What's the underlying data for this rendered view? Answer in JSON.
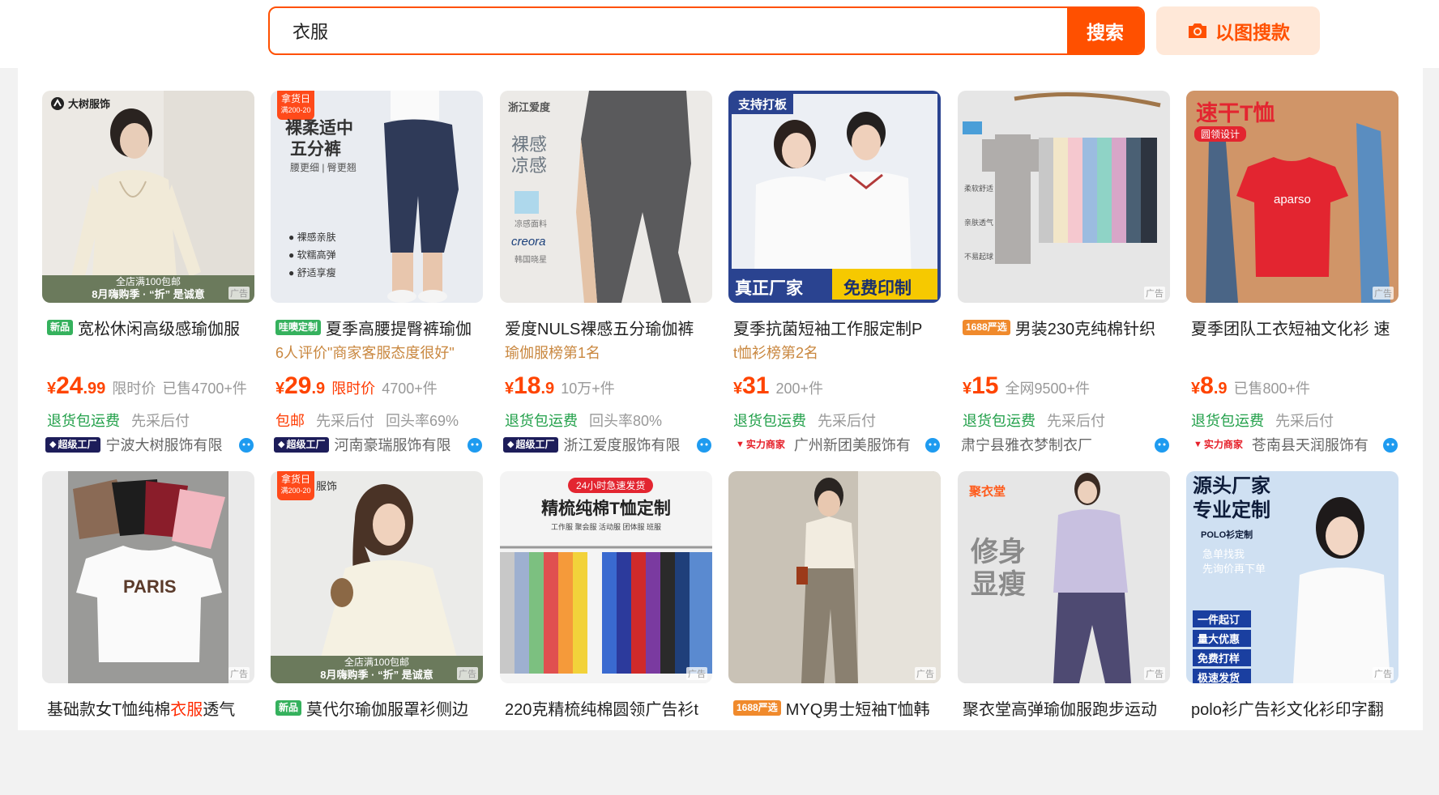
{
  "search": {
    "query": "衣服",
    "button_label": "搜索",
    "image_search_label": "以图搜款"
  },
  "colors": {
    "accent": "#ff5000",
    "price": "#ff4400",
    "green": "#22a04a"
  },
  "products_row1": [
    {
      "badge": "新品",
      "title": "宽松休闲高级感瑜伽服",
      "price_yen": "¥",
      "price_int": "24",
      "price_dec": ".99",
      "extra1": "限时价",
      "extra2": "已售4700+件",
      "tag1": "退货包运费",
      "tag2": "先采后付",
      "shop_badge": "超级工厂",
      "shop_name": "宁波大树服饰有限",
      "thumb_brand": "大树服饰",
      "thumb_footer1": "8月嗨购季 · “折” 是诚意",
      "thumb_footer2": "全店满100包邮",
      "ad": "广告"
    },
    {
      "badge": "哇噢定制",
      "title": "夏季高腰提臀裤瑜伽",
      "sub": "6人评价\"商家客服态度很好\"",
      "price_yen": "¥",
      "price_int": "29",
      "price_dec": ".9",
      "extra1": "限时价",
      "extra2": "4700+件",
      "tag1": "包邮",
      "tag2": "先采后付",
      "tag3": "回头率69%",
      "shop_badge": "超级工厂",
      "shop_name": "河南豪瑞服饰有限",
      "thumb_promo1": "拿货日",
      "thumb_promo2": "满200-20",
      "thumb_text1": "裸柔适中",
      "thumb_text2": "五分裤",
      "thumb_text3": "腰更细 | 臀更翘",
      "thumb_feat1": "裸感亲肤",
      "thumb_feat2": "软糯高弹",
      "thumb_feat3": "舒适享瘦",
      "ad": "广告"
    },
    {
      "title": "爱度NULS裸感五分瑜伽裤",
      "sub": "瑜伽服榜第1名",
      "price_yen": "¥",
      "price_int": "18",
      "price_dec": ".9",
      "extra2": "10万+件",
      "tag1": "退货包运费",
      "tag2": "回头率80%",
      "shop_badge": "超级工厂",
      "shop_name": "浙江爱度服饰有限",
      "thumb_text1": "浙江爱度",
      "thumb_text2": "裸感",
      "thumb_text3": "凉感",
      "thumb_text4": "凉感面料",
      "thumb_text5": "creora",
      "thumb_text6": "韩国晓星",
      "ad": "广告"
    },
    {
      "title": "夏季抗菌短袖工作服定制P",
      "sub": "t恤衫榜第2名",
      "price_yen": "¥",
      "price_int": "31",
      "price_dec": "",
      "extra2": "200+件",
      "tag1": "退货包运费",
      "tag2": "先采后付",
      "shop_badge": "实力商家",
      "shop_name": "广州新团美服饰有",
      "thumb_text1": "支持打板",
      "thumb_text2": "真正厂家",
      "thumb_text3": "免费印制",
      "ad": "广告"
    },
    {
      "badge": "1688严选",
      "title": "男装230克纯棉针织",
      "price_yen": "¥",
      "price_int": "15",
      "price_dec": "",
      "extra2": "全网9500+件",
      "tag1": "退货包运费",
      "tag2": "先采后付",
      "shop_name": "肃宁县雅衣梦制衣厂",
      "thumb_text1": "柔软舒适",
      "thumb_text2": "亲肤透气",
      "thumb_text3": "不易起球",
      "ad": "广告"
    },
    {
      "title": "夏季团队工衣短袖文化衫 速",
      "price_yen": "¥",
      "price_int": "8",
      "price_dec": ".9",
      "extra2": "已售800+件",
      "tag1": "退货包运费",
      "tag2": "先采后付",
      "shop_badge": "实力商家",
      "shop_name": "苍南县天润服饰有",
      "thumb_text1": "速干T恤",
      "thumb_text2": "圆领设计",
      "thumb_text3": "aparso",
      "ad": "广告"
    }
  ],
  "products_row2": [
    {
      "title_pre": "基础款女T恤纯棉",
      "title_hl": "衣服",
      "title_post": "透气",
      "thumb_text1": "PARIS",
      "ad": "广告"
    },
    {
      "badge": "新品",
      "title": "莫代尔瑜伽服罩衫侧边",
      "thumb_promo1": "拿货日",
      "thumb_promo2": "满200-20",
      "thumb_text1": "服饰",
      "thumb_footer1": "8月嗨购季 · “折” 是诚意",
      "thumb_footer2": "全店满100包邮",
      "ad": "广告"
    },
    {
      "title": "220克精梳纯棉圆领广告衫t",
      "thumb_text1": "24小时急速发货",
      "thumb_text2": "精梳纯棉T恤定制",
      "thumb_text3": "工作服 聚会服 活动服 团体服 班服",
      "ad": "广告"
    },
    {
      "badge": "1688严选",
      "title": "MYQ男士短袖T恤韩",
      "ad": "广告"
    },
    {
      "title": "聚衣堂高弹瑜伽服跑步运动",
      "thumb_text1": "聚衣堂",
      "thumb_text2": "修身",
      "thumb_text3": "显瘦",
      "ad": "广告"
    },
    {
      "title": "polo衫广告衫文化衫印字翻",
      "thumb_text1": "源头厂家",
      "thumb_text2": "专业定制",
      "thumb_text3": "POLO衫定制",
      "thumb_text4": "急单找我",
      "thumb_text5": "先询价再下单",
      "thumb_feat1": "一件起订",
      "thumb_feat2": "量大优惠",
      "thumb_feat3": "免费打样",
      "thumb_feat4": "极速发货",
      "ad": "广告"
    }
  ]
}
